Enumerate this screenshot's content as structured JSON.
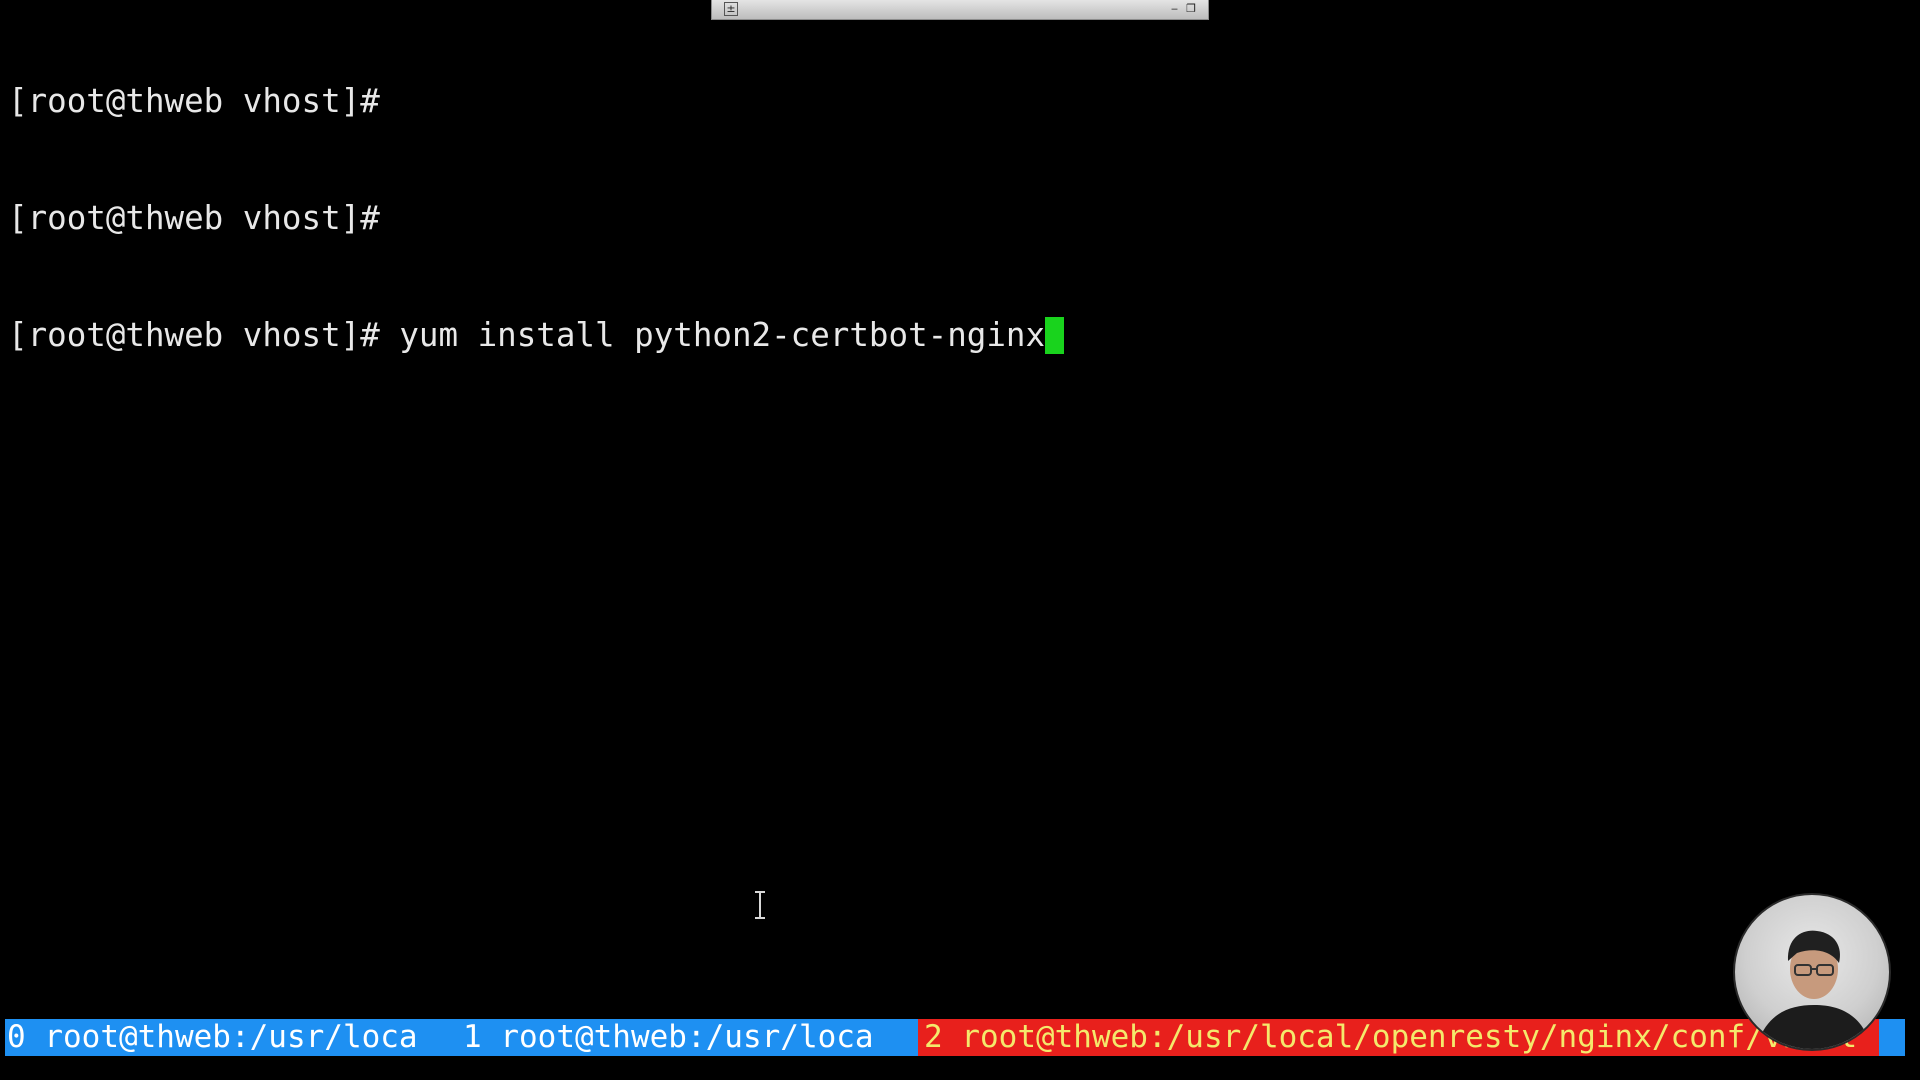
{
  "terminal": {
    "lines": [
      "[root@thweb vhost]#",
      "[root@thweb vhost]#",
      "[root@thweb vhost]# yum install python2-certbot-nginx"
    ],
    "cursor_color": "#19d31d"
  },
  "statusbar": {
    "windows": [
      {
        "label": "0 root@thweb:/usr/loca"
      },
      {
        "label": "1 root@thweb:/usr/loca"
      },
      {
        "label": "2 root@thweb:/usr/local/openresty/nginx/conf/vhost"
      }
    ],
    "active_index": 2,
    "colors": {
      "bar": "#1e90f2",
      "active_bg": "#e8201c",
      "active_fg": "#f4e96c"
    }
  },
  "toolbar": {
    "icons": [
      "pin-icon",
      "minimize-icon",
      "restore-icon"
    ]
  },
  "overlay": {
    "pointer": "ibeam-cursor-icon",
    "webcam": "presenter-webcam"
  }
}
